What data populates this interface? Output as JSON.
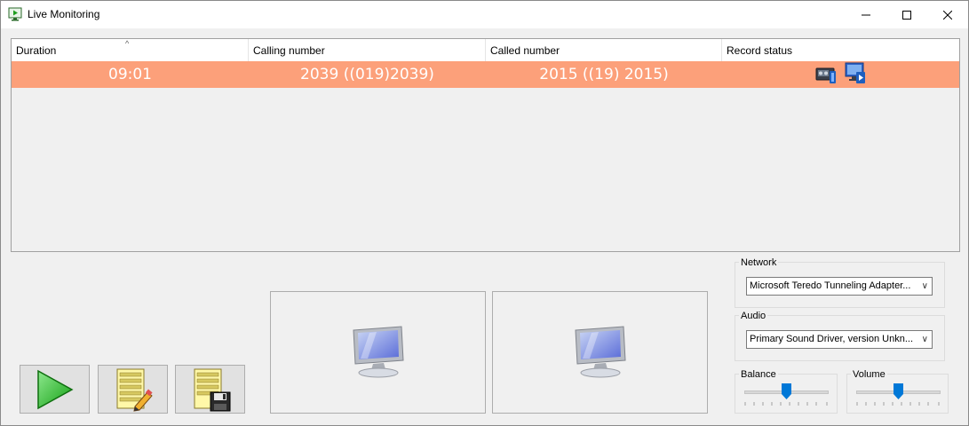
{
  "window": {
    "title": "Live Monitoring"
  },
  "grid": {
    "columns": [
      "Duration",
      "Calling number",
      "Called number",
      "Record status"
    ],
    "sort_indicator": "^",
    "rows": [
      {
        "duration": "09:01",
        "calling": "2039 ((019)2039)",
        "called": "2015 ((19) 2015)",
        "status_icons": [
          "tape-recorder-icon",
          "monitor-speaker-icon"
        ]
      }
    ]
  },
  "network": {
    "label": "Network",
    "selected": "Microsoft Teredo Tunneling Adapter..."
  },
  "audio": {
    "label": "Audio",
    "selected": "Primary Sound Driver, version Unkn..."
  },
  "balance": {
    "label": "Balance",
    "value_fraction": 0.5
  },
  "volume": {
    "label": "Volume",
    "value_fraction": 0.5
  },
  "colors": {
    "selected_row": "#fca07a",
    "play_green": "#2eb82e"
  }
}
